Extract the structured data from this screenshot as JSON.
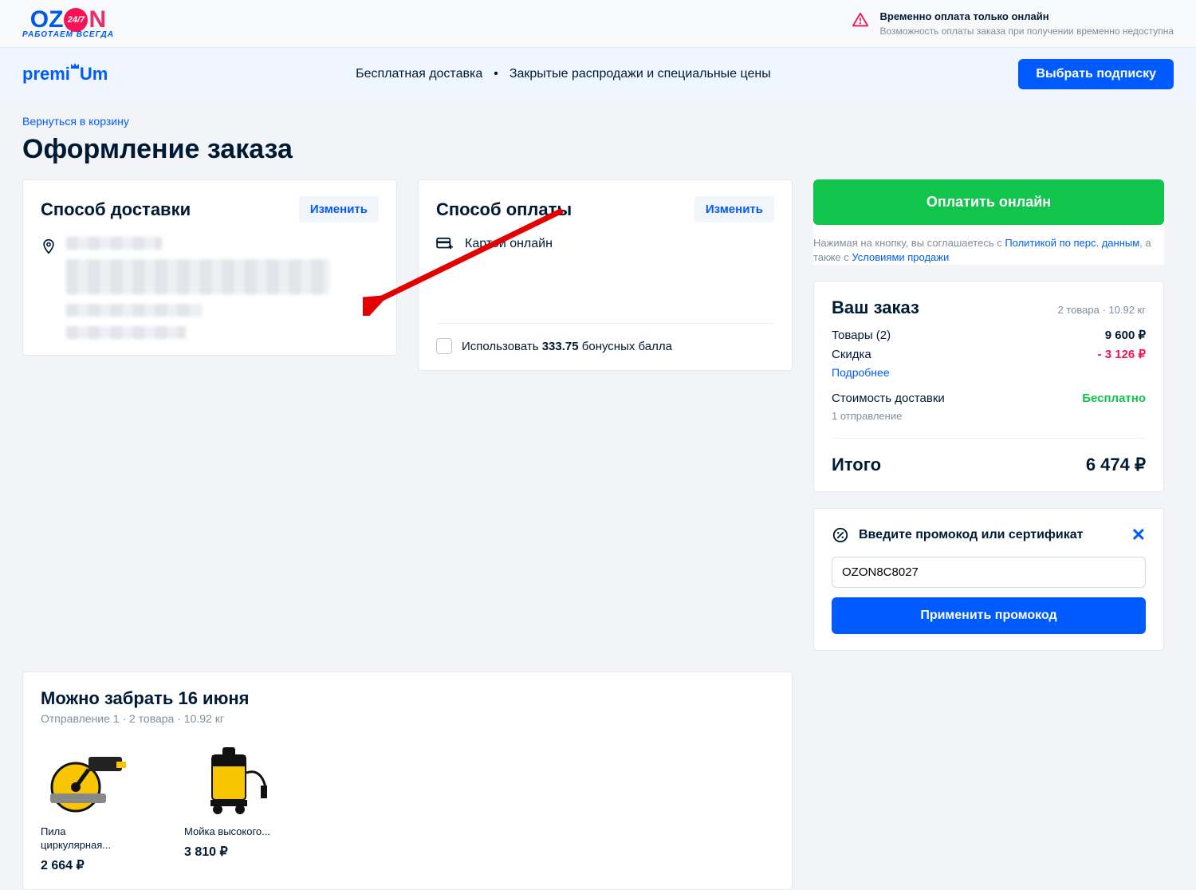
{
  "topbar": {
    "logo_main": "OZON",
    "logo_badge": "24/7",
    "logo_tagline": "РАБОТАЕМ ВСЕГДА",
    "notice_title": "Временно оплата только онлайн",
    "notice_sub": "Возможность оплаты заказа при получении временно недоступна"
  },
  "premium": {
    "brand": "premiUm",
    "benefit_1": "Бесплатная доставка",
    "benefit_2": "Закрытые распродажи и специальные цены",
    "cta": "Выбрать подписку"
  },
  "page": {
    "back": "Вернуться в корзину",
    "title": "Оформление заказа"
  },
  "delivery": {
    "title": "Способ доставки",
    "change": "Изменить"
  },
  "payment": {
    "title": "Способ оплаты",
    "change": "Изменить",
    "method": "Картой онлайн",
    "bonus_prefix": "Использовать ",
    "bonus_amount": "333.75",
    "bonus_suffix": " бонусных балла"
  },
  "pickup": {
    "title": "Можно забрать 16 июня",
    "sub": "Отправление 1 · 2 товара · 10.92 кг",
    "items": [
      {
        "name": "Пила циркулярная...",
        "price": "2 664 ₽"
      },
      {
        "name": "Мойка высокого...",
        "price": "3 810 ₽"
      }
    ]
  },
  "summary": {
    "pay_btn": "Оплатить онлайн",
    "agree_1": "Нажимая на кнопку, вы соглашаетесь с ",
    "agree_link1": "Политикой по перс. данным",
    "agree_2": ", а также с ",
    "agree_link2": "Условиями продажи",
    "order_title": "Ваш заказ",
    "order_meta": "2 товара · 10.92 кг",
    "goods_label": "Товары (2)",
    "goods_value": "9 600 ₽",
    "discount_label": "Скидка",
    "discount_value": "- 3 126 ₽",
    "discount_more": "Подробнее",
    "ship_label": "Стоимость доставки",
    "ship_value": "Бесплатно",
    "ship_sub": "1 отправление",
    "total_label": "Итого",
    "total_value": "6 474 ₽"
  },
  "promo": {
    "header": "Введите промокод или сертификат",
    "code": "OZON8C8027",
    "apply": "Применить промокод"
  }
}
